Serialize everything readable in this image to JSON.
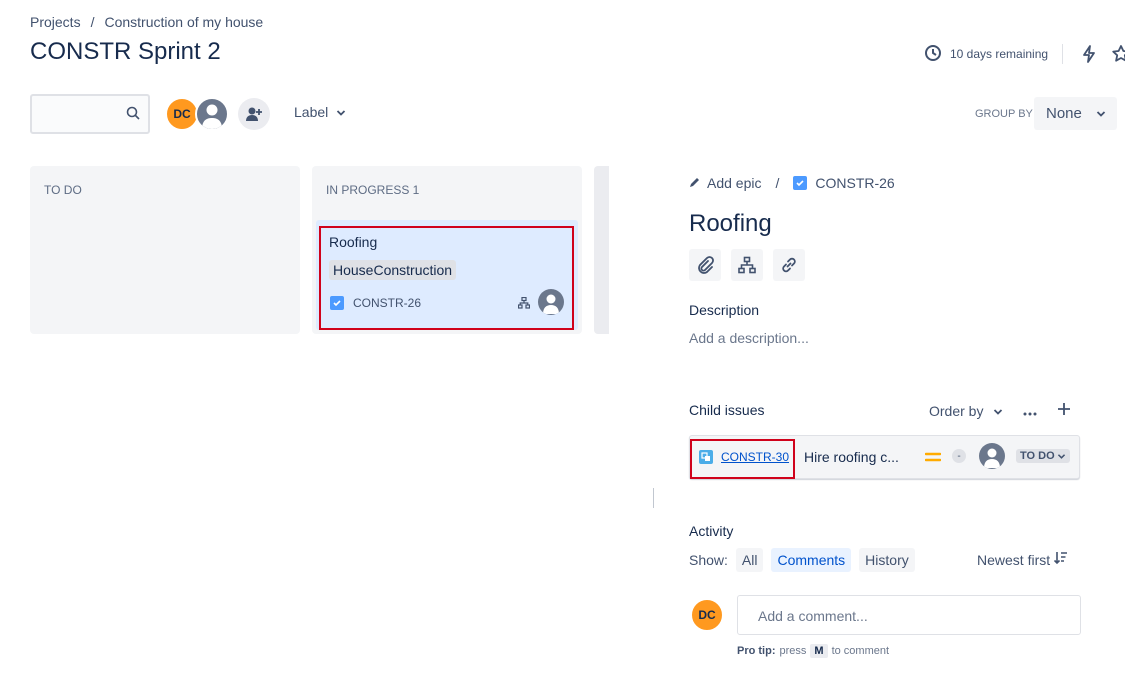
{
  "breadcrumb": {
    "projects": "Projects",
    "separator": "/",
    "project": "Construction of my house"
  },
  "sprint": {
    "title": "CONSTR Sprint 2",
    "remaining": "10 days remaining"
  },
  "toolbar": {
    "search_placeholder": "",
    "avatar_initials": "DC",
    "label_filter": "Label",
    "group_by_label": "GROUP BY",
    "group_by_value": "None"
  },
  "board": {
    "columns": [
      {
        "title": "TO DO"
      },
      {
        "title": "IN PROGRESS 1"
      }
    ],
    "card": {
      "title": "Roofing",
      "label": "HouseConstruction",
      "key": "CONSTR-26"
    }
  },
  "detail": {
    "add_epic": "Add epic",
    "separator": "/",
    "issue_key": "CONSTR-26",
    "title": "Roofing",
    "description_heading": "Description",
    "description_placeholder": "Add a description...",
    "child_issues_heading": "Child issues",
    "order_by": "Order by",
    "child": {
      "key": "CONSTR-30",
      "summary": "Hire roofing c...",
      "badge": "-",
      "status": "TO DO"
    },
    "activity_heading": "Activity",
    "show_label": "Show:",
    "filters": [
      "All",
      "Comments",
      "History"
    ],
    "sort": "Newest first",
    "commenter_initials": "DC",
    "comment_placeholder": "Add a comment...",
    "pro_tip_label": "Pro tip:",
    "pro_tip_press": "press",
    "pro_tip_key": "M",
    "pro_tip_suffix": "to comment"
  },
  "colors": {
    "accent_blue": "#0052cc",
    "avatar_orange": "#ff991f",
    "card_selected": "#deebff",
    "highlight_red": "#d0021b",
    "priority_medium": "#ffab00"
  }
}
